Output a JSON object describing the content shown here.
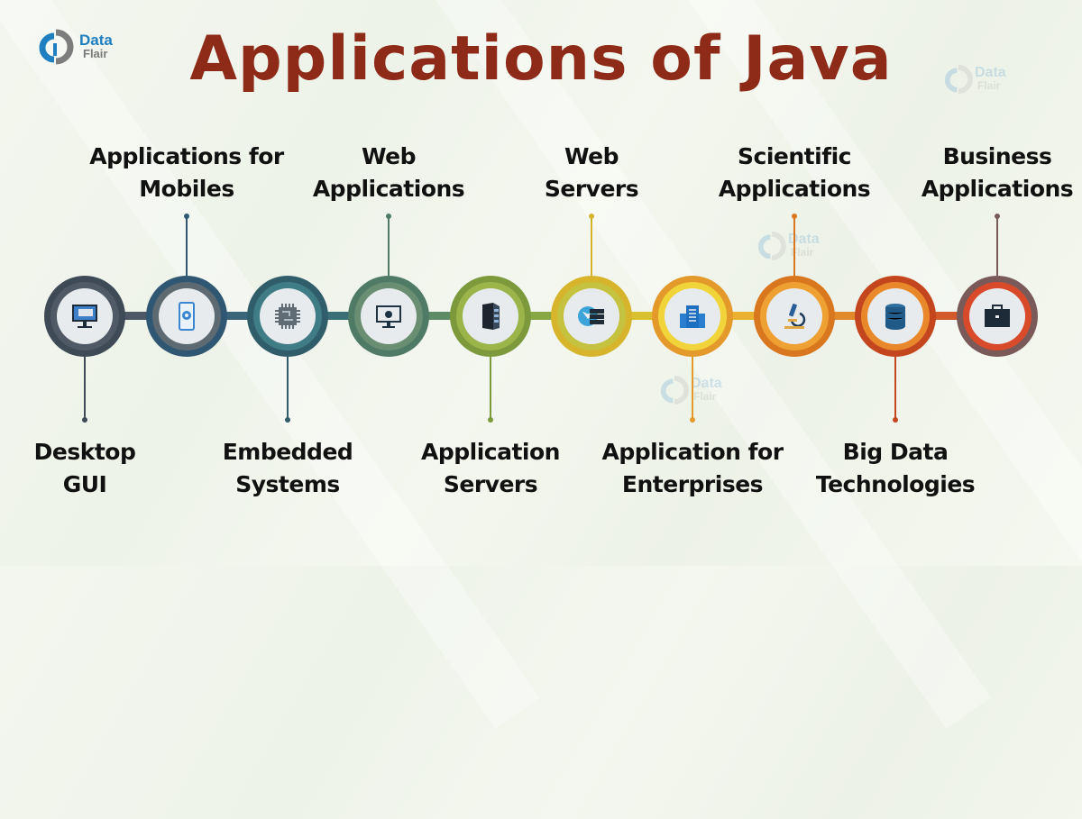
{
  "title": "Applications of Java",
  "brand": {
    "line1": "Data",
    "line2": "Flair"
  },
  "watermark": {
    "line1": "Data",
    "line2": "Flair"
  },
  "items": [
    {
      "label_line1": "Desktop",
      "label_line2": "GUI",
      "position": "below",
      "icon": "desktop-monitor-icon",
      "color_outer": "#3f4a57",
      "color_inner": "#4f5a66"
    },
    {
      "label_line1": "Applications for",
      "label_line2": "Mobiles",
      "position": "above",
      "icon": "mobile-gear-icon",
      "color_outer": "#2f5773",
      "color_inner": "#5d6a72"
    },
    {
      "label_line1": "Embedded",
      "label_line2": "Systems",
      "position": "below",
      "icon": "microchip-icon",
      "color_outer": "#2f5e6a",
      "color_inner": "#3f7c86"
    },
    {
      "label_line1": "Web",
      "label_line2": "Applications",
      "position": "above",
      "icon": "web-app-monitor-icon",
      "color_outer": "#4f7a66",
      "color_inner": "#6a8e72"
    },
    {
      "label_line1": "Application",
      "label_line2": "Servers",
      "position": "below",
      "icon": "server-rack-icon",
      "color_outer": "#7c9a3c",
      "color_inner": "#9bb54a"
    },
    {
      "label_line1": "Web",
      "label_line2": "Servers",
      "position": "above",
      "icon": "globe-server-icon",
      "color_outer": "#d6b52c",
      "color_inner": "#c4c23e"
    },
    {
      "label_line1": "Application for",
      "label_line2": "Enterprises",
      "position": "below",
      "icon": "office-building-icon",
      "color_outer": "#e49a2a",
      "color_inner": "#f0d43a"
    },
    {
      "label_line1": "Scientific",
      "label_line2": "Applications",
      "position": "above",
      "icon": "microscope-icon",
      "color_outer": "#d9771e",
      "color_inner": "#eea032"
    },
    {
      "label_line1": "Big Data",
      "label_line2": "Technologies",
      "position": "below",
      "icon": "database-icon",
      "color_outer": "#c4461e",
      "color_inner": "#e8882a"
    },
    {
      "label_line1": "Business",
      "label_line2": "Applications",
      "position": "above",
      "icon": "briefcase-icon",
      "color_outer": "#7a5a58",
      "color_inner": "#d94a2a"
    }
  ],
  "colors": {
    "title": "#8e2a18",
    "brand_blue": "#1f7fc0",
    "brand_gray": "#7a7a7a"
  }
}
